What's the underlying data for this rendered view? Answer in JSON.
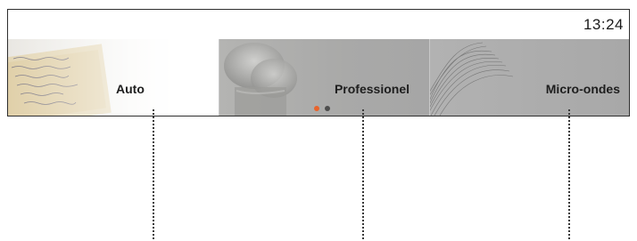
{
  "status_bar": {
    "time": "13:24"
  },
  "tabs": [
    {
      "label": "Auto",
      "icon": "handwritten-recipe-icon"
    },
    {
      "label": "Professionel",
      "icon": "chef-hat-icon"
    },
    {
      "label": "Micro-ondes",
      "icon": "microwave-waves-icon"
    }
  ],
  "pager": {
    "total_pages": 2,
    "current_page": 1
  },
  "colors": {
    "pager_active": "#e8642c",
    "pager_inactive": "#4d4d4d",
    "tab_gray": "#a8a8a8"
  }
}
